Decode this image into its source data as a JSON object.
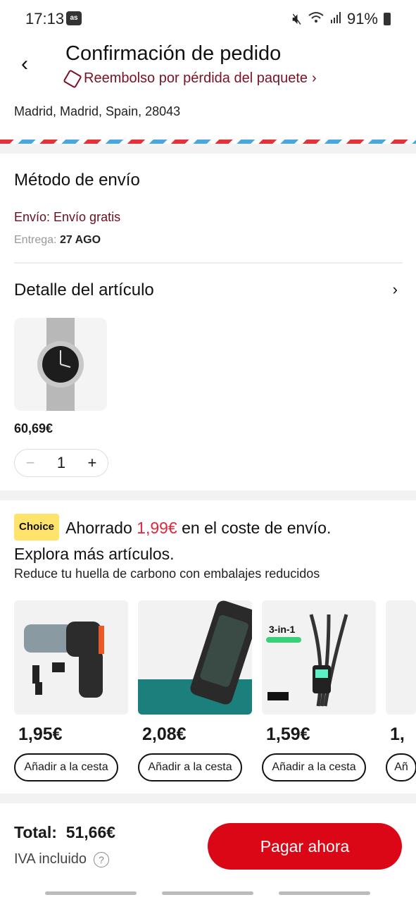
{
  "status": {
    "time": "17:13",
    "carrier_logo": "as",
    "battery": "91%"
  },
  "header": {
    "title": "Confirmación de pedido",
    "refund_link": "Reembolso por pérdida del paquete"
  },
  "address": "Madrid, Madrid, Spain, 28043",
  "shipping": {
    "title": "Método de envío",
    "method": "Envío: Envío gratis",
    "delivery_label": "Entrega:",
    "delivery_date": "27 AGO"
  },
  "item_detail": {
    "title": "Detalle del artículo",
    "price": "60,69€",
    "quantity": "1"
  },
  "choice": {
    "badge": "Choice",
    "saved_prefix": "Ahorrado",
    "saved_amount": "1,99€",
    "saved_suffix": "en el coste de envío.",
    "explore": "Explora más artículos.",
    "carbon": "Reduce tu huella de carbono con embalajes reducidos"
  },
  "products": [
    {
      "price": "1,95€",
      "button": "Añadir a la cesta"
    },
    {
      "price": "2,08€",
      "button": "Añadir a la cesta"
    },
    {
      "price": "1,59€",
      "button": "Añadir a la cesta"
    },
    {
      "price": "1,",
      "button": "Añ"
    }
  ],
  "footer": {
    "total_label": "Total:",
    "total_value": "51,66€",
    "iva": "IVA incluido",
    "pay_button": "Pagar ahora"
  },
  "colors": {
    "accent": "#dc0716",
    "ship": "#6a0f1f",
    "choice": "#ffe36b"
  }
}
